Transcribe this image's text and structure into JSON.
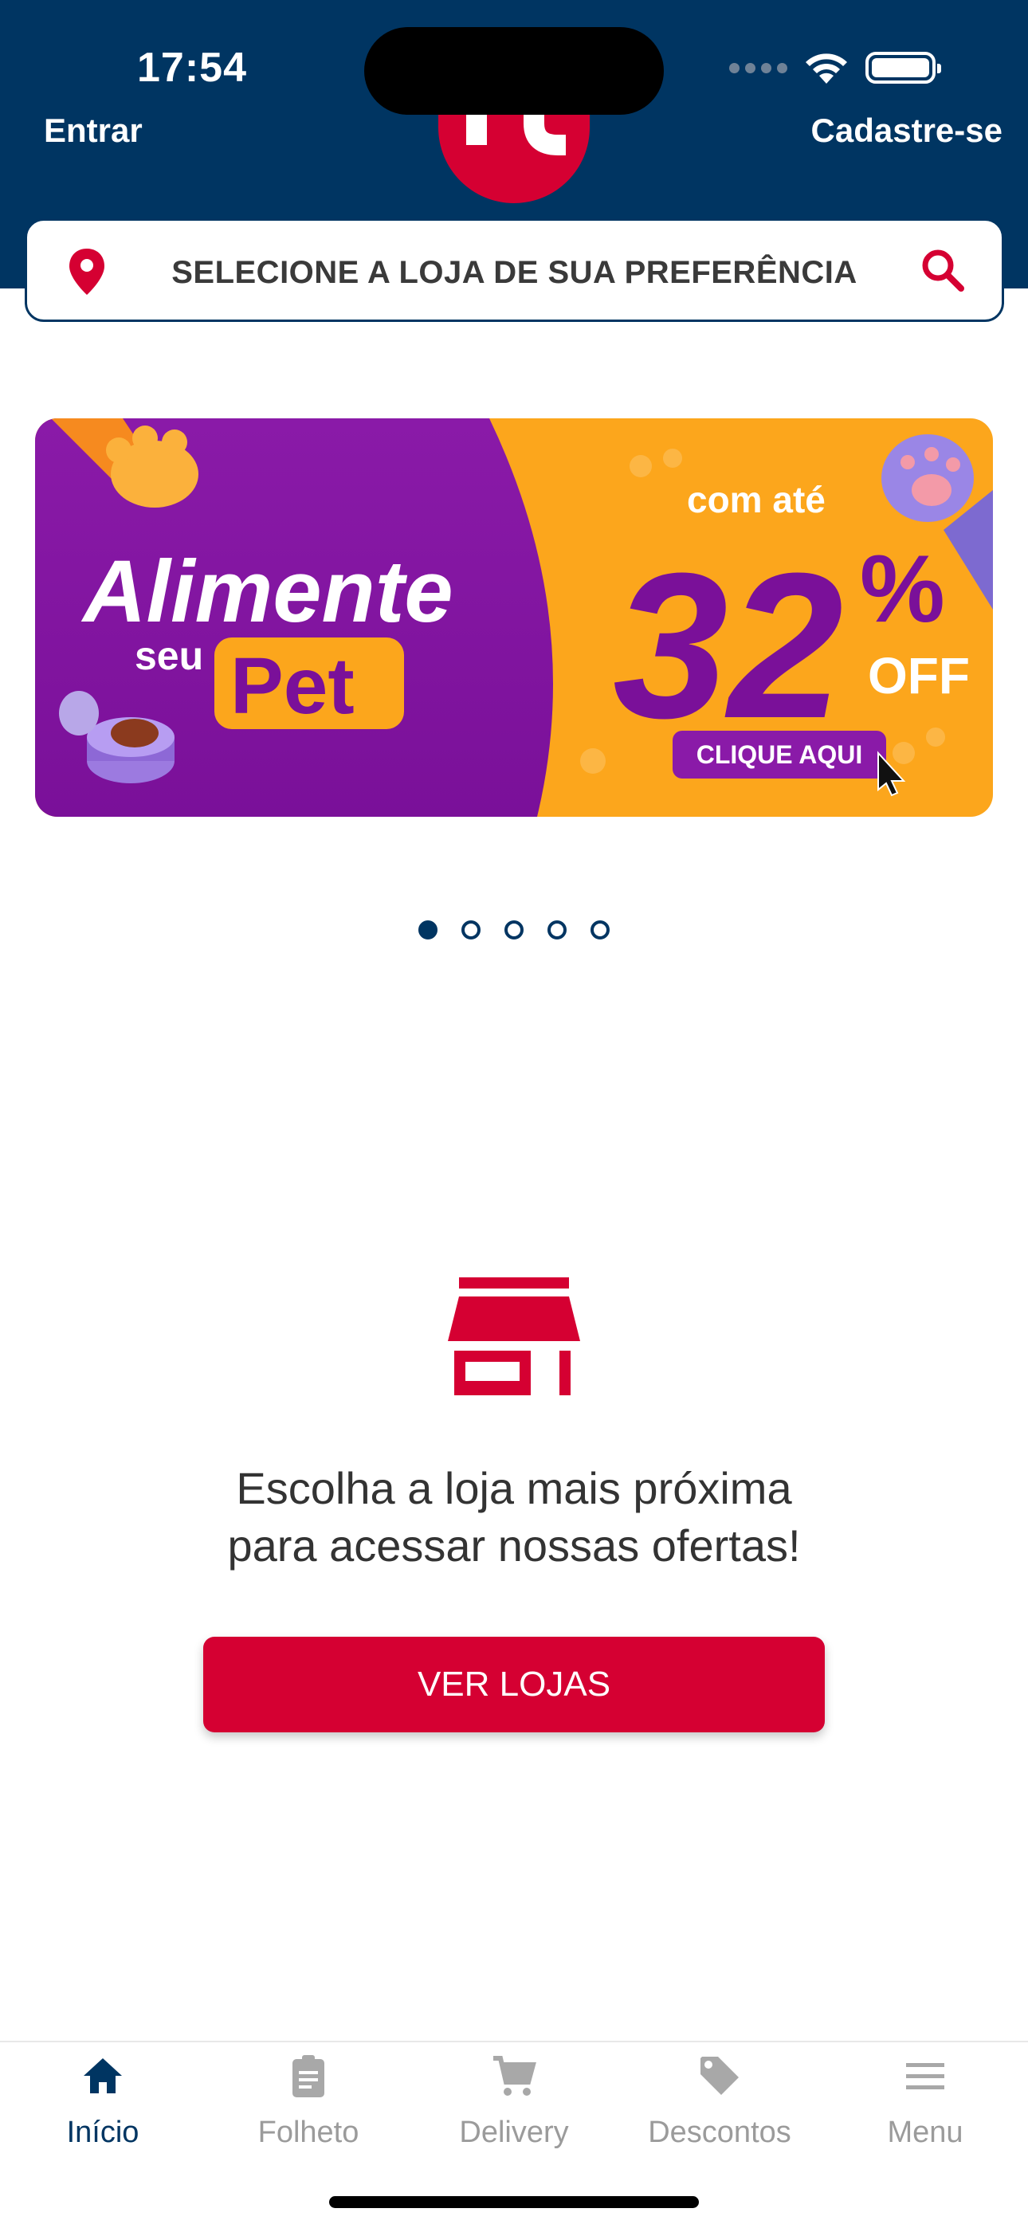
{
  "status_bar": {
    "time": "17:54"
  },
  "header": {
    "login": "Entrar",
    "signup": "Cadastre-se",
    "logo_color": "#d50032",
    "background": "#003562"
  },
  "store_selector": {
    "label": "SELECIONE A LOJA DE SUA PREFERÊNCIA",
    "left_icon": "location-pin-icon",
    "right_icon": "search-icon"
  },
  "banner": {
    "headline_line1": "Alimente",
    "headline_seu": "seu",
    "headline_pet": "Pet",
    "com_ate": "com até",
    "discount_number": "32",
    "percent": "%",
    "off": "OFF",
    "cta": "CLIQUE AQUI"
  },
  "carousel": {
    "count": 5,
    "active_index": 0
  },
  "empty_state": {
    "icon": "store-icon",
    "line1": "Escolha a loja mais próxima",
    "line2": "para acessar nossas ofertas!",
    "button": "VER LOJAS"
  },
  "tabbar": {
    "items": [
      {
        "label": "Início",
        "icon": "home-icon",
        "active": true
      },
      {
        "label": "Folheto",
        "icon": "clipboard-icon",
        "active": false
      },
      {
        "label": "Delivery",
        "icon": "cart-icon",
        "active": false
      },
      {
        "label": "Descontos",
        "icon": "tag-icon",
        "active": false
      },
      {
        "label": "Menu",
        "icon": "hamburger-menu-icon",
        "active": false
      }
    ]
  },
  "colors": {
    "brand_red": "#d50032",
    "brand_blue": "#003562",
    "inactive_grey": "#9b9b9b"
  }
}
